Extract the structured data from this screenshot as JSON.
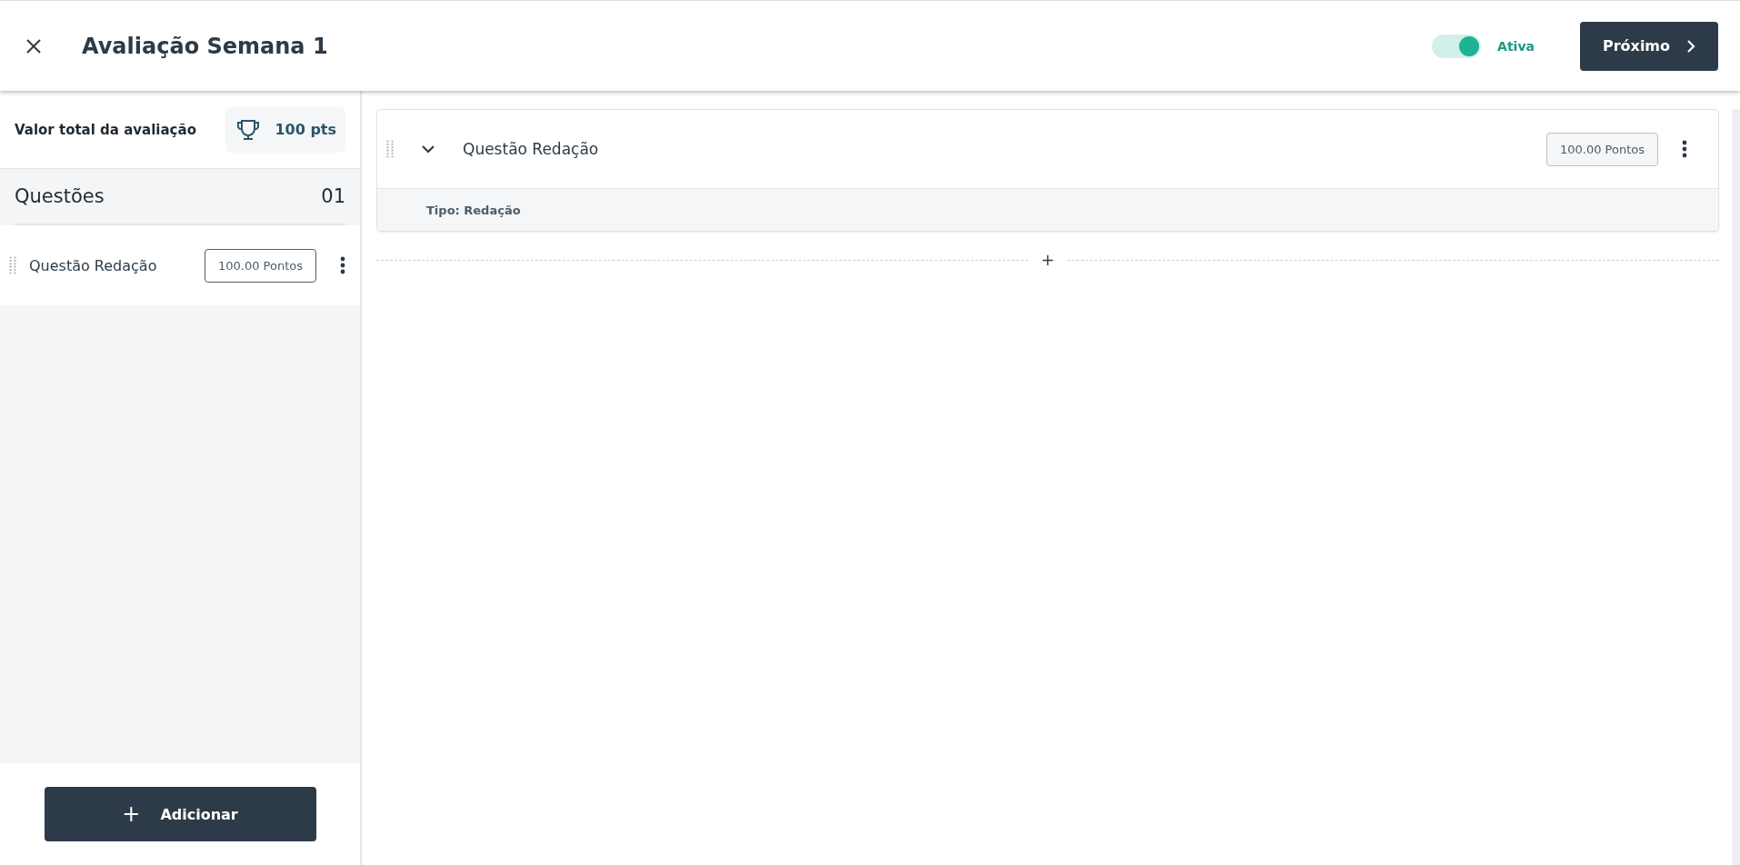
{
  "header": {
    "title": "Avaliação Semana 1",
    "toggle": {
      "on": true,
      "label": "Ativa"
    },
    "next_button": "Próximo"
  },
  "sidebar": {
    "total_label": "Valor total da avaliação",
    "total_value": "100 pts",
    "questions_title": "Questões",
    "questions_count": "01",
    "questions": [
      {
        "title": "Questão Redação",
        "points": "100.00 Pontos"
      }
    ],
    "add_button": "Adicionar",
    "add_icon": "+"
  },
  "main": {
    "questions": [
      {
        "title": "Questão Redação",
        "points": "100.00 Pontos",
        "expanded": true,
        "type": "Tipo: Redação"
      }
    ],
    "insert_icon": "+"
  }
}
